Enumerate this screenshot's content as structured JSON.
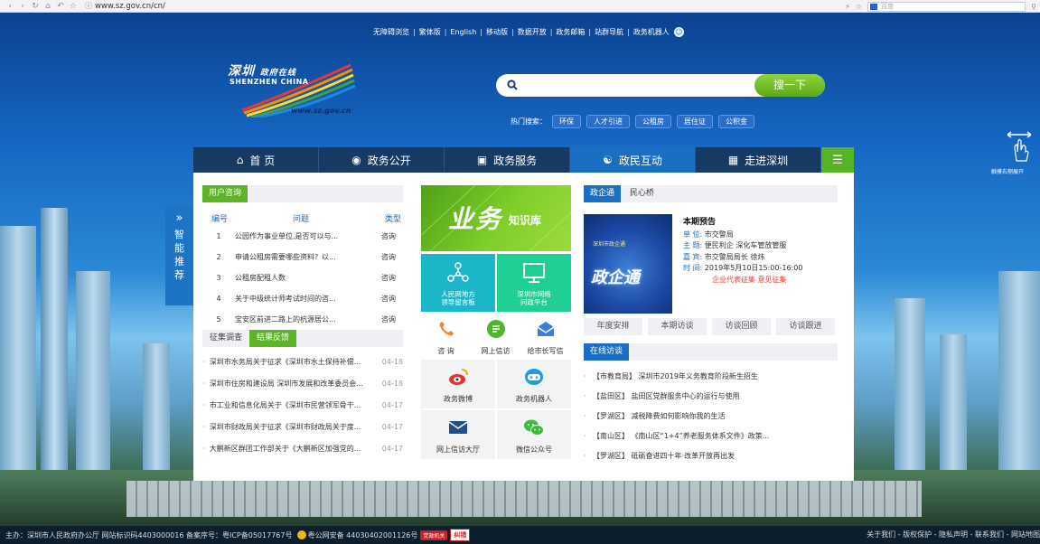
{
  "browser": {
    "url": "www.sz.gov.cn/cn/",
    "search_engine": "百度"
  },
  "top_links": [
    "无障碍浏览",
    "繁体版",
    "English",
    "移动版",
    "数据开放",
    "政务邮箱",
    "站群导航",
    "政务机器人"
  ],
  "logo": {
    "cn_title": "深圳",
    "cn_sub": "政府在线",
    "en_title": "SHENZHEN CHINA",
    "url": "www.sz.gov.cn"
  },
  "search": {
    "placeholder": "",
    "button": "搜一下",
    "hot_label": "热门搜索：",
    "hot_tags": [
      "环保",
      "人才引进",
      "公租房",
      "居住证",
      "公积金"
    ]
  },
  "nav": [
    "首 页",
    "政务公开",
    "政务服务",
    "政民互动",
    "走进深圳"
  ],
  "side_tab": {
    "label_chars": [
      "智",
      "能",
      "推",
      "荐"
    ]
  },
  "consult": {
    "tab": "用户咨询",
    "headers": [
      "编号",
      "问题",
      "类型"
    ],
    "rows": [
      {
        "num": "1",
        "q": "公园作为事业单位,是否可以与...",
        "type": "咨询"
      },
      {
        "num": "2",
        "q": "申请公租房需要哪些资料？以...",
        "type": "咨询"
      },
      {
        "num": "3",
        "q": "公租房配租人数",
        "type": "咨询"
      },
      {
        "num": "4",
        "q": "关于中级统计师考试时间的咨...",
        "type": "咨询"
      },
      {
        "num": "5",
        "q": "宝安区前进二路上的杭源居公...",
        "type": "咨询"
      }
    ]
  },
  "survey": {
    "tabs": [
      "征集调查",
      "结果反馈"
    ],
    "items": [
      {
        "title": "深圳市水务局关于征求《深圳市水土保持补偿...",
        "date": "04-18"
      },
      {
        "title": "深圳市住房和建设局 深圳市发展和改革委员会...",
        "date": "04-18"
      },
      {
        "title": "市工业和信息化局关于《深圳市民营领军骨干...",
        "date": "04-17"
      },
      {
        "title": "深圳市财政局关于征求《深圳市财政局关于度...",
        "date": "04-17"
      },
      {
        "title": "大鹏新区群团工作部关于《大鹏新区加强党的...",
        "date": "04-17"
      }
    ]
  },
  "knowledge": {
    "big": "业务",
    "small": "知识库",
    "tiles": [
      {
        "line1": "人民网地方",
        "line2": "领导留言板"
      },
      {
        "line1": "深圳市网络",
        "line2": "问政平台"
      }
    ],
    "icons": [
      "咨 询",
      "网上信访",
      "给市长写信"
    ],
    "grid": [
      "政务微博",
      "政务机器人",
      "网上信访大厅",
      "微信公众号"
    ]
  },
  "gov_enterprise": {
    "tabs": [
      "政企通",
      "民心桥"
    ],
    "image_text": "政企通",
    "image_label": "深圳市政企通",
    "heading": "本期预告",
    "unit_label": "单 位:",
    "unit": "市交警局",
    "topic_label": "主 题:",
    "topic": "便民利企 深化车管放管服",
    "guest_label": "嘉 宾:",
    "guest": "市交警局局长 徐炜",
    "time_label": "时 间:",
    "time": "2019年5月10日15:00-16:00",
    "links": [
      "企业代表征集",
      "意见征集"
    ],
    "buttons": [
      "年度安排",
      "本期访谈",
      "访谈回顾",
      "访谈跟进"
    ]
  },
  "online_interview": {
    "tab": "在线访谈",
    "items": [
      {
        "org": "【市教育局】",
        "title": "深圳市2019年义务教育阶段新生招生"
      },
      {
        "org": "【盐田区】",
        "title": "盐田区党群服务中心的运行与使用"
      },
      {
        "org": "【罗湖区】",
        "title": "减税降费如何影响你我的生活"
      },
      {
        "org": "【南山区】",
        "title": "《南山区“1+4”养老服务体系文件》政策..."
      },
      {
        "org": "【罗湖区】",
        "title": "砥砺奋进四十年·改革开放再出发"
      }
    ]
  },
  "right_hint": "触摸右侧展开",
  "footer": {
    "left": "主办：深圳市人民政府办公厅   网站标识码4403000016   备案序号：粤ICP备05017767号",
    "police": "粤公网安备 44030402001126号",
    "badge1": "党政机关",
    "badge2": "纠错",
    "right": "关于我们 - 版权保护 - 隐私声明 - 联系我们 - 网站地图"
  },
  "colors": {
    "nav_bg": "#173a63",
    "nav_active": "#1b6fc2",
    "green": "#5bb526",
    "blue": "#1b6fc2"
  }
}
